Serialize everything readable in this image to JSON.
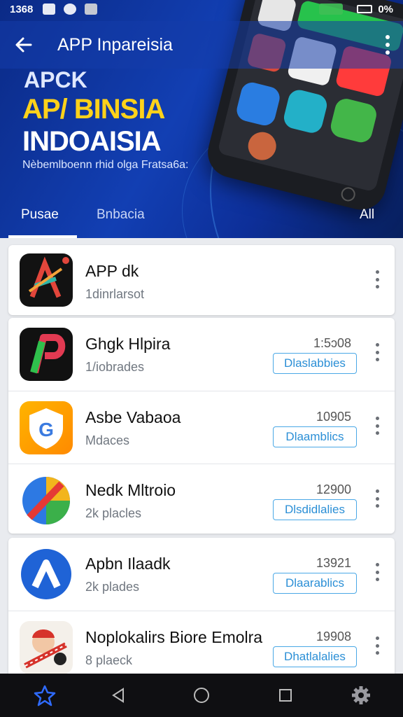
{
  "status_bar": {
    "time": "1368",
    "battery_text": "0%"
  },
  "app_bar": {
    "title": "APP Inpareisia"
  },
  "promo": {
    "line1": "APCK",
    "line2": "AP/ BINSIA",
    "line3": "INDOAISIA",
    "subtitle": "Nèbemlboenn rhid olga Fratsa6a:"
  },
  "tabs": [
    {
      "label": "Pusae",
      "active": true
    },
    {
      "label": "Bnbacia",
      "active": false
    },
    {
      "label": "All",
      "active": false
    }
  ],
  "apps": [
    {
      "name": "APP dk",
      "sub": "1dinrlarsot",
      "number": "",
      "status": ""
    },
    {
      "name": "Ghgk Hlpira",
      "sub": "1/iobrades",
      "number": "1:5ɔ08",
      "status": "Dlaslabbies"
    },
    {
      "name": "Asbe Vabaoa",
      "sub": "Mdaces",
      "number": "10905",
      "status": "Dlaamblics"
    },
    {
      "name": "Nedk Mltroio",
      "sub": "2k placles",
      "number": "12900",
      "status": "Dlsdidlalies"
    },
    {
      "name": "Apbn Ilaadk",
      "sub": "2k plades",
      "number": "13921",
      "status": "Dlaarablics"
    },
    {
      "name": "Noplokalirs Biore Emolra",
      "sub": "8 plaeck",
      "number": "19908",
      "status": "Dhatlalalies"
    }
  ],
  "colors": {
    "accent": "#2b8fd6",
    "hero": "#123fb3",
    "promo_yellow": "#ffd21a"
  },
  "bottom_nav": [
    "star-icon",
    "back-triangle-icon",
    "home-circle-icon",
    "recents-square-icon",
    "settings-gear-icon"
  ]
}
